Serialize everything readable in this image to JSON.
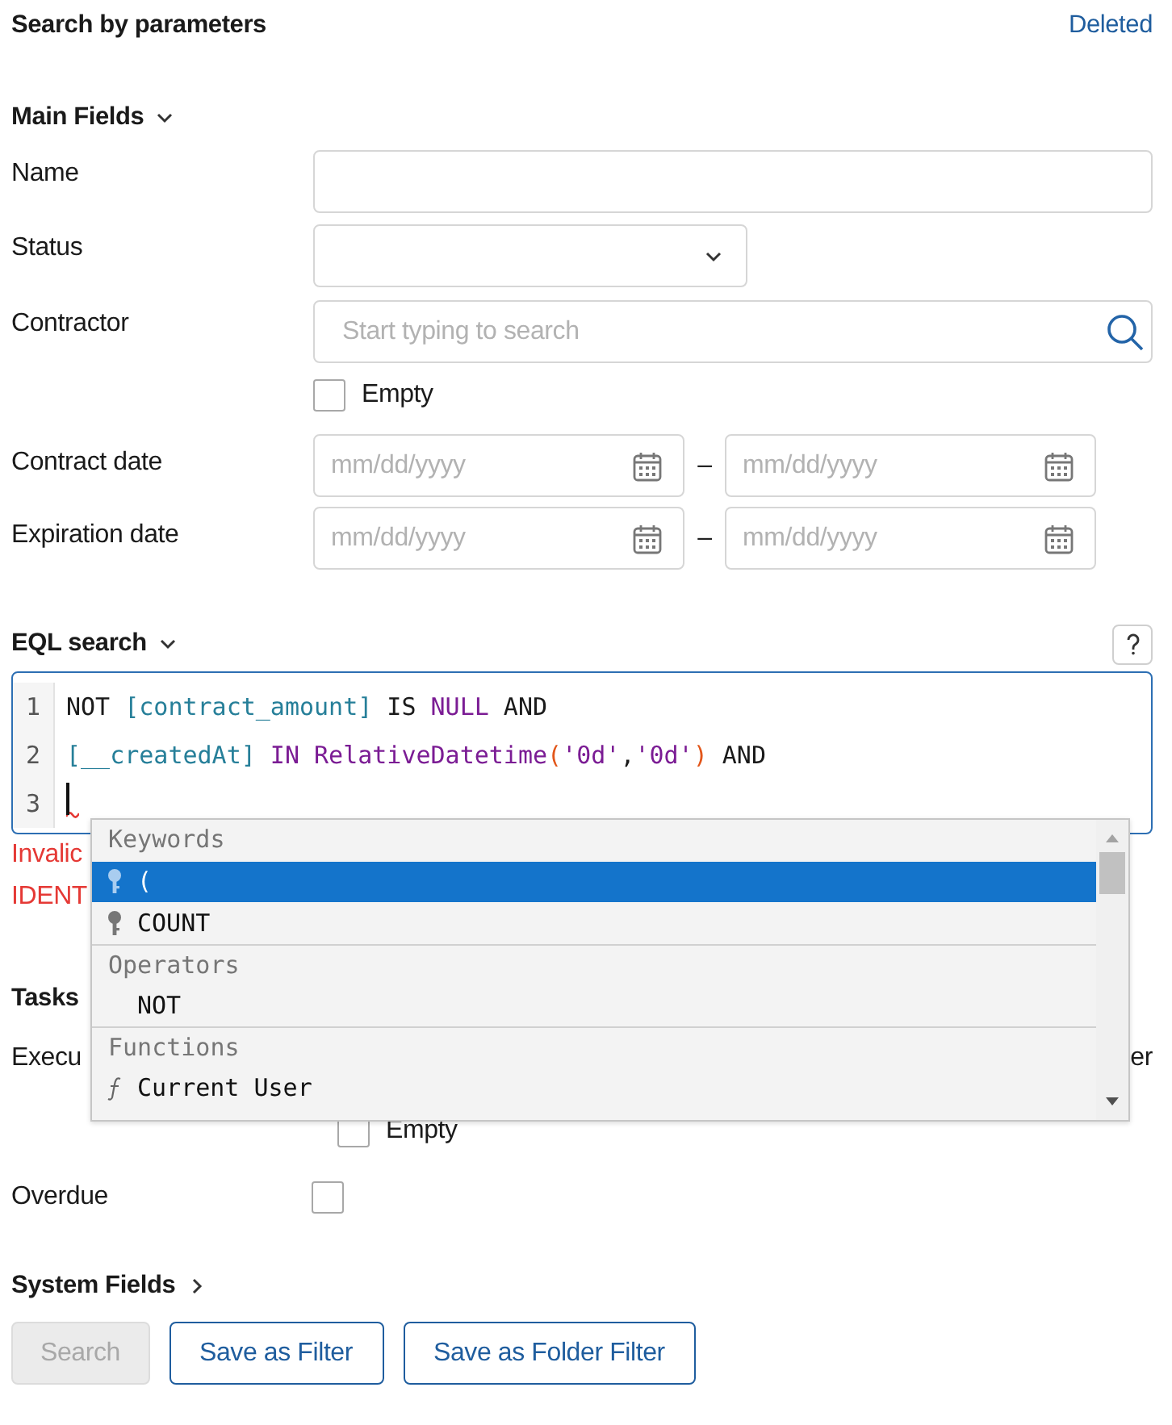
{
  "title": "Search by parameters",
  "deleted_link": "Deleted",
  "main_fields": {
    "label": "Main Fields",
    "expanded": true,
    "fields": [
      {
        "kind": "text",
        "label": "Name"
      },
      {
        "kind": "select",
        "label": "Status"
      },
      {
        "kind": "lookup",
        "label": "Contractor",
        "placeholder": "Start typing to search",
        "empty": {
          "label": "Empty",
          "checked": false
        }
      },
      {
        "kind": "daterange",
        "label": "Contract date",
        "from_placeholder": "mm/dd/yyyy",
        "separator": "–",
        "to_placeholder": "mm/dd/yyyy"
      },
      {
        "kind": "daterange",
        "label": "Expiration date",
        "from_placeholder": "mm/dd/yyyy",
        "separator": "–",
        "to_placeholder": "mm/dd/yyyy"
      }
    ]
  },
  "eql": {
    "label": "EQL search",
    "expanded": true,
    "lines": [
      {
        "number": "1",
        "tokens": [
          {
            "kind": "keyword",
            "text": "NOT "
          },
          {
            "kind": "field",
            "text": "[contract_amount]"
          },
          {
            "kind": "keyword",
            "text": " IS "
          },
          {
            "kind": "constant",
            "text": "NULL"
          },
          {
            "kind": "keyword",
            "text": " AND"
          }
        ]
      },
      {
        "number": "2",
        "tokens": [
          {
            "kind": "field",
            "text": "[__createdAt]"
          },
          {
            "kind": "constant",
            "text": " IN RelativeDatetime"
          },
          {
            "kind": "paren",
            "text": "("
          },
          {
            "kind": "string",
            "text": "'0d'"
          },
          {
            "kind": "keyword",
            "text": ","
          },
          {
            "kind": "string",
            "text": "'0d'"
          },
          {
            "kind": "paren",
            "text": ")"
          },
          {
            "kind": "keyword",
            "text": " AND"
          }
        ]
      },
      {
        "number": "3",
        "error": true,
        "cursor": true
      }
    ]
  },
  "errors": [
    "Invalic",
    "IDENT"
  ],
  "tasks": {
    "label": "Tasks",
    "rows": [
      {
        "kind": "user",
        "label": "Execu",
        "value": "er",
        "empty": {
          "label": "Empty",
          "checked": false
        }
      },
      {
        "kind": "checkbox",
        "label": "Overdue",
        "checked": false
      }
    ]
  },
  "system_fields": {
    "label": "System Fields",
    "expanded": false
  },
  "buttons": [
    {
      "label": "Search",
      "disabled": true
    },
    {
      "label": "Save as Filter",
      "disabled": false
    },
    {
      "label": "Save as Folder Filter",
      "disabled": false
    }
  ],
  "autocomplete": {
    "groups": [
      {
        "kind": "keyword",
        "title": "Keywords",
        "items": [
          {
            "label": "(",
            "selected": true
          },
          {
            "label": "COUNT",
            "selected": false
          }
        ]
      },
      {
        "kind": "operator",
        "title": "Operators",
        "items": [
          {
            "label": "NOT",
            "selected": false
          }
        ]
      },
      {
        "kind": "function",
        "title": "Functions",
        "items": [
          {
            "label": "Current User",
            "selected": false
          }
        ]
      }
    ]
  }
}
